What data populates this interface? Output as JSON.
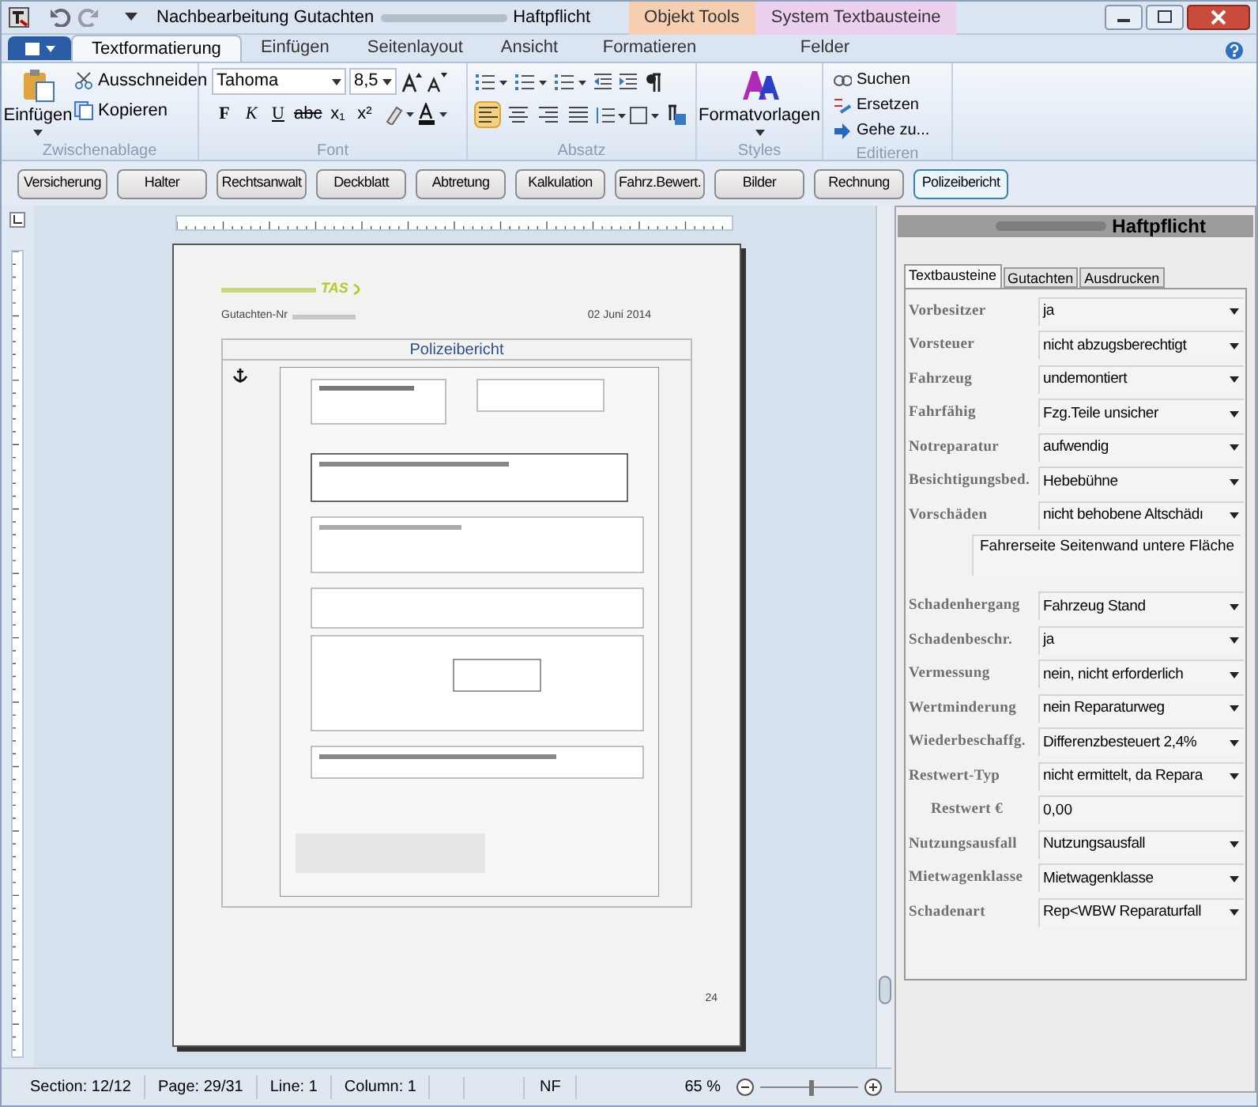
{
  "window": {
    "title_parts": [
      "Nachbearbeitung Gutachten",
      "Haftpflicht"
    ]
  },
  "context_tabs": [
    {
      "label": "Objekt Tools",
      "color": "#f6cfb0"
    },
    {
      "label": "System Textbausteine",
      "color": "#ecd0f0"
    }
  ],
  "ribbon_tabs": [
    {
      "label": "Textformatierung",
      "selected": true
    },
    {
      "label": "Einfügen",
      "selected": false
    },
    {
      "label": "Seitenlayout",
      "selected": false
    },
    {
      "label": "Ansicht",
      "selected": false
    },
    {
      "label": "Formatieren",
      "selected": false
    },
    {
      "label": "Felder",
      "selected": false
    }
  ],
  "clipboard": {
    "paste": "Einfügen",
    "cut": "Ausschneiden",
    "copy": "Kopieren",
    "group": "Zwischenablage"
  },
  "font": {
    "name": "Tahoma",
    "size": "8,5",
    "styles": [
      "F",
      "K",
      "U",
      "abc",
      "x₁",
      "x²"
    ],
    "group": "Font"
  },
  "paragraph": {
    "group": "Absatz",
    "alignments": [
      {
        "selected": true
      },
      {
        "selected": false
      },
      {
        "selected": false
      },
      {
        "selected": false
      }
    ]
  },
  "styles": {
    "button": "Formatvorlagen",
    "group": "Styles"
  },
  "editing": {
    "items": [
      "Suchen",
      "Ersetzen",
      "Gehe zu..."
    ],
    "group": "Editieren"
  },
  "section_buttons": [
    {
      "label": "Versicherung",
      "selected": false
    },
    {
      "label": "Halter",
      "selected": false
    },
    {
      "label": "Rechtsanwalt",
      "selected": false
    },
    {
      "label": "Deckblatt",
      "selected": false
    },
    {
      "label": "Abtretung",
      "selected": false
    },
    {
      "label": "Kalkulation",
      "selected": false
    },
    {
      "label": "Fahrz.Bewert.",
      "selected": false
    },
    {
      "label": "Bilder",
      "selected": false
    },
    {
      "label": "Rechnung",
      "selected": false
    },
    {
      "label": "Polizeibericht",
      "selected": true
    }
  ],
  "document": {
    "logo": "TAS",
    "ref_label": "Gutachten-Nr",
    "date": "02 Juni 2014",
    "heading": "Polizeibericht",
    "page_number": "24"
  },
  "panel": {
    "title": "Haftpflicht",
    "tabs": [
      {
        "label": "Textbausteine",
        "selected": true
      },
      {
        "label": "Gutachten",
        "selected": false
      },
      {
        "label": "Ausdrucken",
        "selected": false
      }
    ],
    "fields": [
      {
        "kind": "dropdown",
        "label": "Vorbesitzer",
        "value": "ja"
      },
      {
        "kind": "dropdown",
        "label": "Vorsteuer",
        "value": "nicht abzugsberechtigt"
      },
      {
        "kind": "dropdown",
        "label": "Fahrzeug",
        "value": "undemontiert"
      },
      {
        "kind": "dropdown",
        "label": "Fahrfähig",
        "value": "Fzg.Teile unsicher"
      },
      {
        "kind": "dropdown",
        "label": "Notreparatur",
        "value": "aufwendig"
      },
      {
        "kind": "dropdown",
        "label": "Besichtigungsbed.",
        "value": "Hebebühne"
      },
      {
        "kind": "dropdown",
        "label": "Vorschäden",
        "value": "nicht behobene Altschädı"
      },
      {
        "kind": "note",
        "value": "Fahrerseite Seitenwand untere Fläche"
      },
      {
        "kind": "dropdown",
        "label": "Schadenhergang",
        "value": "Fahrzeug Stand"
      },
      {
        "kind": "dropdown",
        "label": "Schadenbeschr.",
        "value": "ja"
      },
      {
        "kind": "dropdown",
        "label": "Vermessung",
        "value": "nein, nicht erforderlich"
      },
      {
        "kind": "dropdown",
        "label": "Wertminderung",
        "value": "nein Reparaturweg"
      },
      {
        "kind": "dropdown",
        "label": "Wiederbeschaffg.",
        "value": "Differenzbesteuert 2,4%"
      },
      {
        "kind": "dropdown",
        "label": "Restwert-Typ",
        "value": "nicht ermittelt, da Repara"
      },
      {
        "kind": "text",
        "label": "Restwert €",
        "value": "0,00"
      },
      {
        "kind": "dropdown",
        "label": "Nutzungsausfall",
        "value": "Nutzungsausfall"
      },
      {
        "kind": "dropdown",
        "label": "Mietwagenklasse",
        "value": "Mietwagenklasse"
      },
      {
        "kind": "dropdown",
        "label": "Schadenart",
        "value": "Rep<WBW Reparaturfall"
      }
    ]
  },
  "status_bar": {
    "items": [
      "Section: 12/12",
      "Page: 29/31",
      "Line: 1",
      "Column: 1"
    ],
    "mode": "NF",
    "zoom": "65 %",
    "zoom_slider": {
      "level": 0.5
    }
  }
}
